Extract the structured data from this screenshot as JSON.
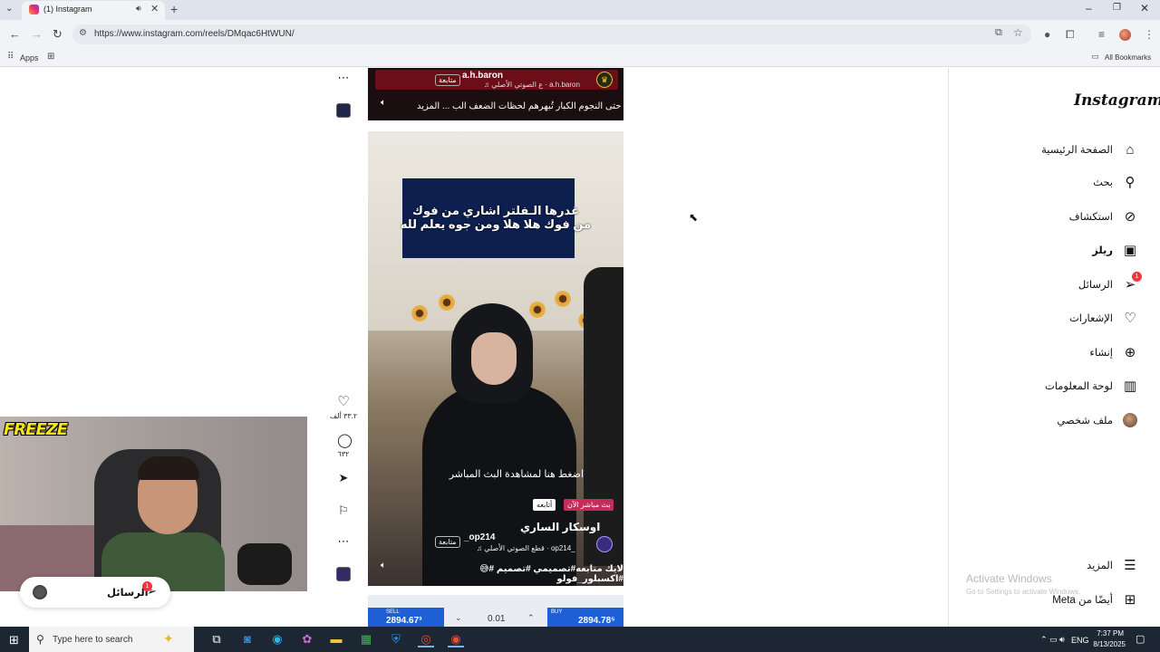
{
  "browser": {
    "tab_title": "(1) Instagram",
    "url": "https://www.instagram.com/reels/DMqac6HtWUN/",
    "bookmarks": {
      "apps": "Apps",
      "all_bookmarks": "All Bookmarks"
    }
  },
  "feed": {
    "prev_reel": {
      "username": "a.h.baron",
      "follow": "متابعة",
      "audio": "♫ ع الصوتي الأصلي · a.h.baron",
      "caption": "حتى النجوم الكبار تُبهرهم لحظات الضعف الب ... المزيد"
    },
    "reel": {
      "overlay_line1": "غدرها الـفلتر اشاري من فوك",
      "overlay_line2": "من فوك هلا هلا ومن جوه يعلم لله",
      "live_banner": "اضغط هنا لمشاهدة البث المباشر",
      "live_badge": "بث مباشر الآن",
      "follow_badge": "أتابعه",
      "live_name": "اوسكار الساري",
      "username": "_op214",
      "follow": "متابعة",
      "audio": "♫ قطع الصوتي الأصلي · op214_",
      "hashtags": "لايك متابعه#تصميمي #تصميم #😅 #اكسبلور_فولو"
    },
    "next_reel": {
      "sell_label": "SELL",
      "sell_price": "2894.67³",
      "lot": "0.01",
      "buy_label": "BUY",
      "buy_price": "2894.78⁵"
    },
    "actions": {
      "likes": "٣٣.٢ ألف",
      "comments": "٦٣٢"
    }
  },
  "sidebar": {
    "logo": "Instagram",
    "items": [
      {
        "label": "الصفحة الرئيسية",
        "icon": "home-icon"
      },
      {
        "label": "بحث",
        "icon": "search-icon"
      },
      {
        "label": "استكشاف",
        "icon": "compass-icon"
      },
      {
        "label": "ريلز",
        "icon": "reels-icon"
      },
      {
        "label": "الرسائل",
        "icon": "messenger-icon",
        "badge": "1"
      },
      {
        "label": "الإشعارات",
        "icon": "heart-icon"
      },
      {
        "label": "إنشاء",
        "icon": "plus-square-icon"
      },
      {
        "label": "لوحة المعلومات",
        "icon": "dashboard-icon"
      },
      {
        "label": "ملف شخصي",
        "icon": "profile-avatar"
      }
    ],
    "more": "المزيد",
    "meta": "أيضًا من Meta"
  },
  "messages_pill": {
    "label": "الرسائل",
    "badge": "1"
  },
  "overlay": {
    "webcam_logo": "FREEZE"
  },
  "watermark": {
    "title": "Activate Windows",
    "subtitle": "Go to Settings to activate Windows."
  },
  "taskbar": {
    "search_placeholder": "Type here to search",
    "lang": "ENG",
    "time": "7:37 PM",
    "date": "8/13/2025"
  }
}
